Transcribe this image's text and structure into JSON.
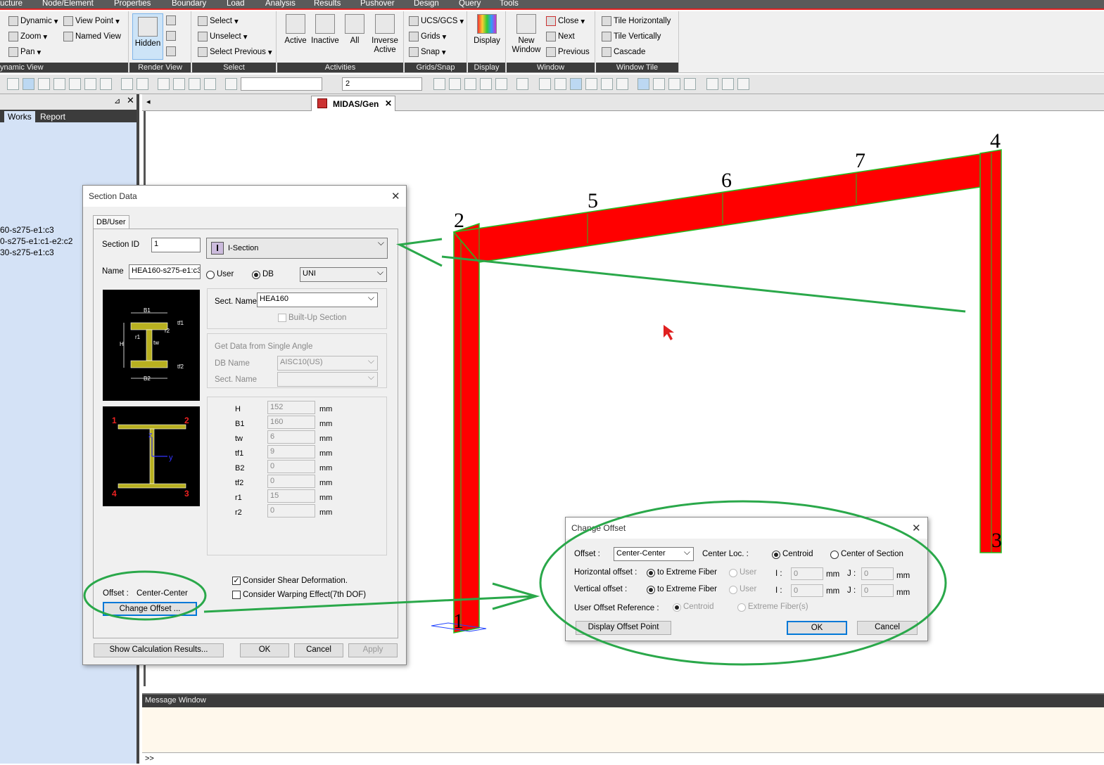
{
  "menu": [
    "ucture",
    "Node/Element",
    "Properties",
    "Boundary",
    "Load",
    "Analysis",
    "Results",
    "Pushover",
    "Design",
    "Query",
    "Tools"
  ],
  "ribbon": {
    "view": {
      "dynamic": "Dynamic",
      "zoom": "Zoom",
      "pan": "Pan",
      "view_point": "View Point",
      "named_view": "Named View",
      "group": "ynamic View"
    },
    "render": {
      "hidden": "Hidden",
      "group": "Render View"
    },
    "select": {
      "select": "Select",
      "unselect": "Unselect",
      "select_previous": "Select Previous",
      "group": "Select"
    },
    "activities": {
      "active": "Active",
      "inactive": "Inactive",
      "all": "All",
      "inverse": "Inverse",
      "inverse2": "Active",
      "group": "Activities"
    },
    "grids": {
      "ucs": "UCS/GCS",
      "grids": "Grids",
      "snap": "Snap",
      "group": "Grids/Snap"
    },
    "display": {
      "display": "Display",
      "group": "Display"
    },
    "window": {
      "new1": "New",
      "new2": "Window",
      "close": "Close",
      "next": "Next",
      "previous": "Previous",
      "group": "Window"
    },
    "tile": {
      "horizontal": "Tile Horizontally",
      "vertical": "Tile Vertically",
      "cascade": "Cascade",
      "group": "Window Tile"
    }
  },
  "toolbar": {
    "combo2": "2"
  },
  "left": {
    "tab_works": "Works",
    "tab_report": "Report",
    "items": [
      "60-s275-e1:c3",
      "0-s275-e1:c1-e2:c2",
      "30-s275-e1:c3"
    ]
  },
  "doc": {
    "tab": "MIDAS/Gen"
  },
  "nodes": [
    "1",
    "2",
    "3",
    "4",
    "5",
    "6",
    "7"
  ],
  "message": {
    "title": "Message Window",
    "prompt": ">>"
  },
  "section": {
    "title": "Section Data",
    "tab": "DB/User",
    "id_label": "Section ID",
    "id": "1",
    "type": "I-Section",
    "name_label": "Name",
    "name": "HEA160-s275-e1:c3",
    "user": "User",
    "db": "DB",
    "db_value": "UNI",
    "sect_name_label": "Sect. Name",
    "sect_name": "HEA160",
    "builtup": "Built-Up Section",
    "single_angle": "Get Data from Single Angle",
    "db_name_label": "DB Name",
    "db_name": "AISC10(US)",
    "sect_name2_label": "Sect. Name",
    "dims": [
      {
        "n": "H",
        "v": "152",
        "u": "mm"
      },
      {
        "n": "B1",
        "v": "160",
        "u": "mm"
      },
      {
        "n": "tw",
        "v": "6",
        "u": "mm"
      },
      {
        "n": "tf1",
        "v": "9",
        "u": "mm"
      },
      {
        "n": "B2",
        "v": "0",
        "u": "mm"
      },
      {
        "n": "tf2",
        "v": "0",
        "u": "mm"
      },
      {
        "n": "r1",
        "v": "15",
        "u": "mm"
      },
      {
        "n": "r2",
        "v": "0",
        "u": "mm"
      }
    ],
    "offset_label": "Offset :",
    "offset_value": "Center-Center",
    "change_offset": "Change Offset ...",
    "shear": "Consider Shear Deformation.",
    "warping": "Consider Warping Effect(7th DOF)",
    "show_calc": "Show Calculation Results...",
    "ok": "OK",
    "cancel": "Cancel",
    "apply": "Apply",
    "fig_labels": {
      "b1": "B1",
      "b2": "B2",
      "h": "H",
      "tf1": "tf1",
      "tf2": "tf2",
      "tw": "tw",
      "r1": "r1",
      "r2": "r2",
      "z": "z",
      "y": "y",
      "p1": "1",
      "p2": "2",
      "p3": "3",
      "p4": "4"
    }
  },
  "offset": {
    "title": "Change Offset",
    "offset_label": "Offset :",
    "offset_value": "Center-Center",
    "center_loc": "Center Loc. :",
    "centroid": "Centroid",
    "center_section": "Center of Section",
    "horizontal": "Horizontal offset :",
    "vertical": "Vertical offset :",
    "extreme": "to Extreme Fiber",
    "user": "User",
    "i": "I :",
    "j": "J :",
    "zero": "0",
    "mm": "mm",
    "ref_label": "User Offset Reference :",
    "ref_centroid": "Centroid",
    "ref_extreme": "Extreme Fiber(s)",
    "display_point": "Display Offset Point",
    "ok": "OK",
    "cancel": "Cancel"
  },
  "colors": {
    "member": "#ff0000",
    "edge": "#22c022",
    "annotation": "#2aa84a"
  }
}
